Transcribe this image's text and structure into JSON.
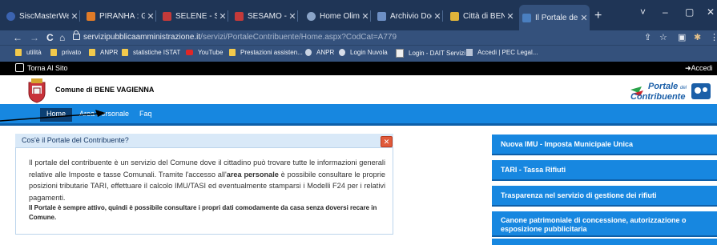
{
  "browser": {
    "tabs": [
      {
        "title": "SiscMasterWeb",
        "fav": "#3b63b0",
        "icon": "globe-icon"
      },
      {
        "title": "PIRANHA : Ges",
        "fav": "#e07b28",
        "icon": "piranha-icon"
      },
      {
        "title": "SELENE - Servi",
        "fav": "#c43a3a",
        "icon": "selene-icon"
      },
      {
        "title": "SESAMO - Serv",
        "fav": "#c43a3a",
        "icon": "sesamo-icon"
      },
      {
        "title": "Home Olimpo",
        "fav": "#8aa4c8",
        "icon": "olimpo-icon"
      },
      {
        "title": "Archivio Docu",
        "fav": "#6d8fc4",
        "icon": "archivio-icon"
      },
      {
        "title": "Città di BENE V",
        "fav": "#e0b43a",
        "icon": "comune-icon"
      },
      {
        "title": "Il Portale del C",
        "fav": "#4a7fc0",
        "icon": "portale-icon"
      }
    ],
    "new_tab": "+",
    "window_controls": {
      "collapse": "˅",
      "minimize": "–",
      "maximize": "▢",
      "close": "✕"
    },
    "nav": {
      "back": "←",
      "forward": "→",
      "reload": "C",
      "home": "⌂"
    },
    "url_host": "servizipubblicaamministrazione.it",
    "url_path": "/servizi/PortaleContribuente/Home.aspx?CodCat=A779",
    "toolbar_icons": {
      "share": "⇪",
      "star": "☆",
      "sidebar": "▣",
      "extension": "✱",
      "menu": "⋮"
    },
    "bookmarks": [
      {
        "label": "utilità",
        "kind": "folder"
      },
      {
        "label": "privato",
        "kind": "folder"
      },
      {
        "label": "ANPR",
        "kind": "folder"
      },
      {
        "label": "statistiche ISTAT",
        "kind": "folder"
      },
      {
        "label": "YouTube",
        "kind": "youtube"
      },
      {
        "label": "Prestazioni assisten...",
        "kind": "folder"
      },
      {
        "label": "ANPR",
        "kind": "globe"
      },
      {
        "label": "Login Nuvola",
        "kind": "nuvola"
      },
      {
        "label": "Login - DAIT Servizi",
        "kind": "dait"
      },
      {
        "label": "Accedi | PEC Legal...",
        "kind": "pec"
      }
    ]
  },
  "site": {
    "back_link": "Torna Al Sito",
    "login_link": "Accedi",
    "comune_name": "Comune di BENE VAGIENNA",
    "logo_line1": "Portale",
    "logo_del": "del",
    "logo_line2": "Contribuente",
    "nav": [
      {
        "label": "Home"
      },
      {
        "label": "Area Personale"
      },
      {
        "label": "Faq"
      }
    ],
    "panel": {
      "title": "Cos'è il Portale del Contribuente?",
      "close": "✕",
      "text_a": "Il portale del contribuente è un servizio del Comune dove il cittadino può trovare tutte le informazioni generali relative alle Imposte e tasse Comunali. Tramite l'accesso all'",
      "text_bold": "area personale",
      "text_b": " è possibile consultare le proprie posizioni tributarie TARI, effettuare il calcolo IMU/TASI ed eventualmente stamparsi i Modelli F24 per i relativi pagamenti.",
      "note": "Il Portale è sempre attivo, quindi è possibile consultare i propri dati comodamente da casa senza doversi recare in Comune."
    },
    "side_links": [
      "Nuova IMU - Imposta Municipale Unica",
      "TARI - Tassa Rifiuti",
      "Trasparenza nel servizio di gestione dei rifiuti",
      "Canone patrimoniale di concessione, autorizzazione o esposizione pubblicitaria"
    ]
  }
}
